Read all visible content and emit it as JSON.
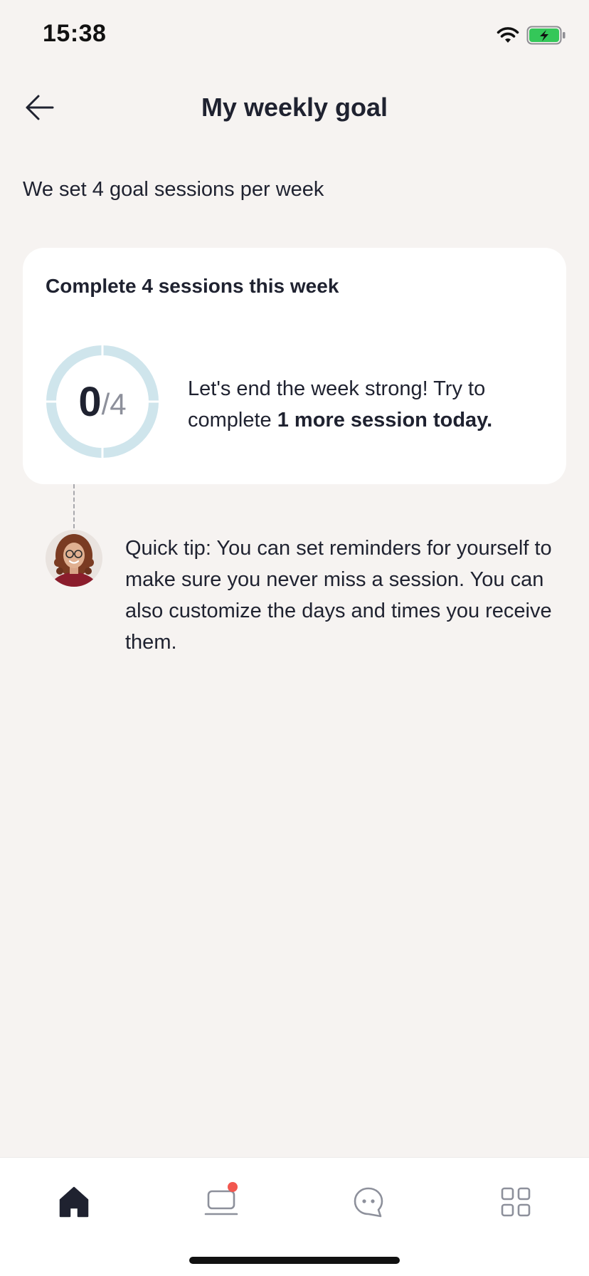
{
  "status_bar": {
    "time": "15:38",
    "icons": [
      "wifi-icon",
      "battery-charging-icon"
    ],
    "battery_color": "#34c759"
  },
  "header": {
    "back_icon": "arrow-left-icon",
    "title": "My weekly goal"
  },
  "subtitle": "We set 4 goal sessions per week",
  "goal_card": {
    "title": "Complete 4 sessions this week",
    "progress": {
      "completed": "0",
      "separator_total": "/4",
      "completed_value": 0,
      "goal_value": 4
    },
    "message_prefix": "Let's end the week strong! Try to complete ",
    "message_emphasis": "1 more session today.",
    "ring_color": "#cfe5ec"
  },
  "tip": {
    "avatar": "coach-avatar",
    "text": "Quick tip: You can set reminders for yourself to make sure you never miss a session. You can also customize the days and times you receive them."
  },
  "bottom_nav": {
    "items": [
      {
        "name": "home",
        "icon": "home-icon",
        "active": true
      },
      {
        "name": "sessions",
        "icon": "laptop-icon",
        "badge": true
      },
      {
        "name": "chat",
        "icon": "chat-bubble-icon"
      },
      {
        "name": "more",
        "icon": "grid-icon"
      }
    ],
    "badge_color": "#f2574f"
  },
  "colors": {
    "background": "#f6f3f1",
    "card": "#ffffff",
    "text": "#1f2230",
    "muted": "#8d909b"
  }
}
